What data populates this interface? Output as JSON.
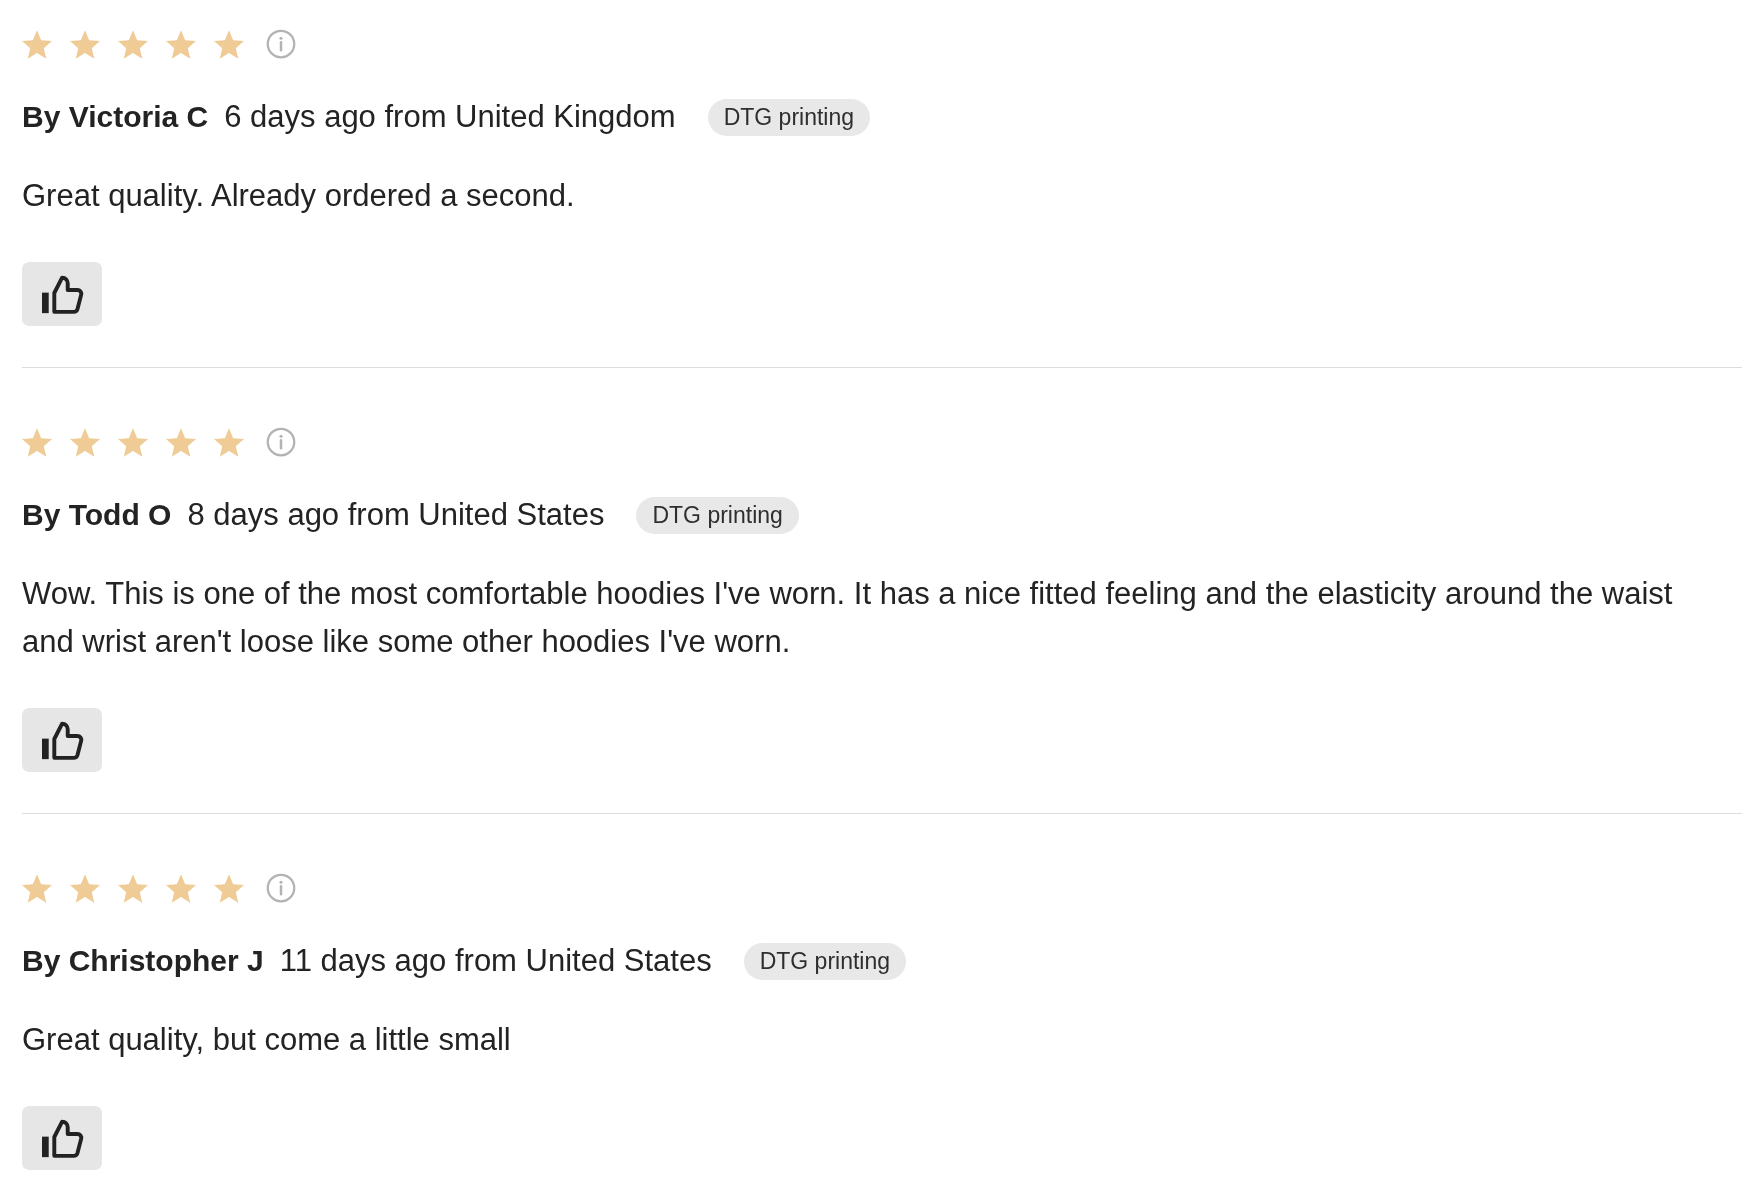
{
  "reviews": [
    {
      "stars": 5,
      "author": "By Victoria C",
      "meta": "6 days ago from United Kingdom",
      "tag": "DTG printing",
      "text": "Great quality. Already ordered a second."
    },
    {
      "stars": 5,
      "author": "By Todd O",
      "meta": "8 days ago from United States",
      "tag": "DTG printing",
      "text": "Wow. This is one of the most comfortable hoodies I've worn. It has a nice fitted feeling and the elasticity around the waist and wrist aren't loose like some other hoodies I've worn."
    },
    {
      "stars": 5,
      "author": "By Christopher J",
      "meta": "11 days ago from United States",
      "tag": "DTG printing",
      "text": "Great quality, but come a little small"
    }
  ]
}
